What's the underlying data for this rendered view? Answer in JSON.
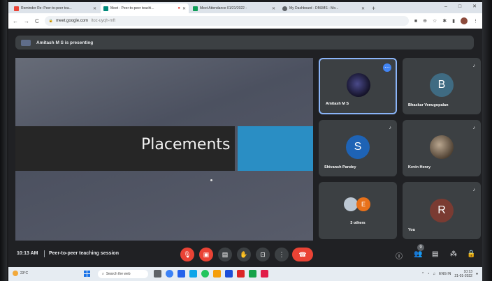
{
  "browser": {
    "tabs": [
      {
        "title": "Reminder Re: Peer-to-peer tea...",
        "icon": "gmail-icon",
        "color": "#ea4335",
        "active": false
      },
      {
        "title": "Meet - Peer-to-peer teachi...",
        "icon": "meet-icon",
        "color": "#00897b",
        "active": true
      },
      {
        "title": "Meet Attendance 01/21/2022 -",
        "icon": "sheets-icon",
        "color": "#0f9d58",
        "active": false
      },
      {
        "title": "My Dashboard - DMJMS - Mo...",
        "icon": "globe-icon",
        "color": "#5f6368",
        "active": false
      }
    ],
    "new_tab": "+",
    "url_host": "meet.google.com",
    "url_path": "/toz-uyqh-mft"
  },
  "meet": {
    "presenting_banner": "Amitash M S is presenting",
    "slide_title": "Placements",
    "participants": [
      {
        "name": "Amitash M S",
        "initial": "",
        "avatar_color": "#1a1838",
        "self_highlight": true
      },
      {
        "name": "Bhaskar Venugopalan",
        "initial": "B",
        "avatar_color": "#3f6b82"
      },
      {
        "name": "Shivansh Pandey",
        "initial": "S",
        "avatar_color": "#1e63b5"
      },
      {
        "name": "Kevin Henry",
        "initial": "",
        "avatar_color": "#6a5a4a"
      },
      {
        "name": "3 others",
        "initial": "E",
        "avatar_color": "#e8711a"
      },
      {
        "name": "You",
        "initial": "R",
        "avatar_color": "#7a3b32"
      }
    ],
    "clock": "10:13 AM",
    "session_title": "Peer-to-peer teaching session",
    "participant_count": "9"
  },
  "taskbar": {
    "temperature": "23°C",
    "search_placeholder": "Search the web",
    "lang": "ENG",
    "lang_sub": "IN",
    "time": "10:13",
    "date": "21-01-2022"
  },
  "colors": {
    "meet_bg": "#202124",
    "tile_bg": "#3c4043",
    "danger": "#ea4335",
    "accent": "#8ab4f8"
  }
}
